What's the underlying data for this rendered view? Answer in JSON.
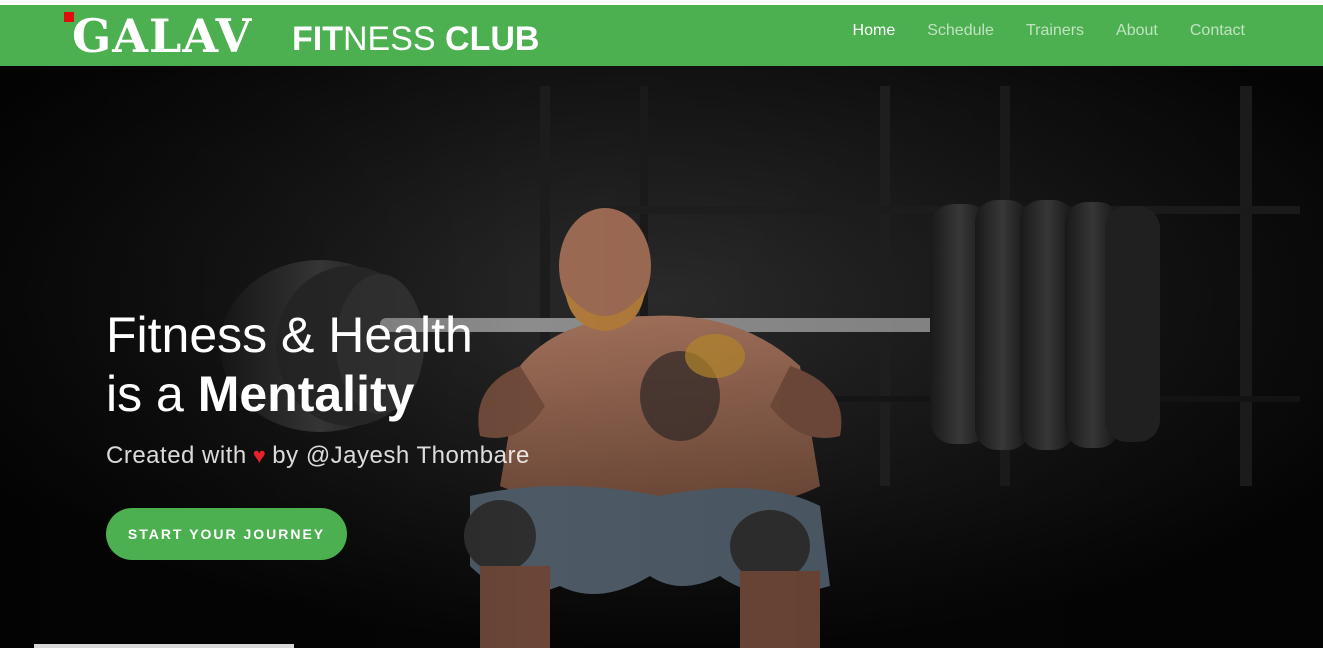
{
  "brand": {
    "logo_text": "GALAV",
    "word1_bold": "FIT",
    "word1_thin": "NESS",
    "word2": "CLUB"
  },
  "nav": {
    "items": [
      {
        "label": "Home",
        "active": true
      },
      {
        "label": "Schedule",
        "active": false
      },
      {
        "label": "Trainers",
        "active": false
      },
      {
        "label": "About",
        "active": false
      },
      {
        "label": "Contact",
        "active": false
      }
    ]
  },
  "hero": {
    "headline_line1": "Fitness & Health",
    "headline_line2_prefix": "is a",
    "headline_line2_bold": "Mentality",
    "credit_prefix": "Created with",
    "credit_suffix": "by @Jayesh Thombare",
    "cta_label": "START YOUR JOURNEY"
  },
  "colors": {
    "brand_green": "#4caf50",
    "heart_red": "#e4222a",
    "logo_mark_red": "#e10d0d"
  },
  "icons": {
    "heart": "heart-icon"
  }
}
